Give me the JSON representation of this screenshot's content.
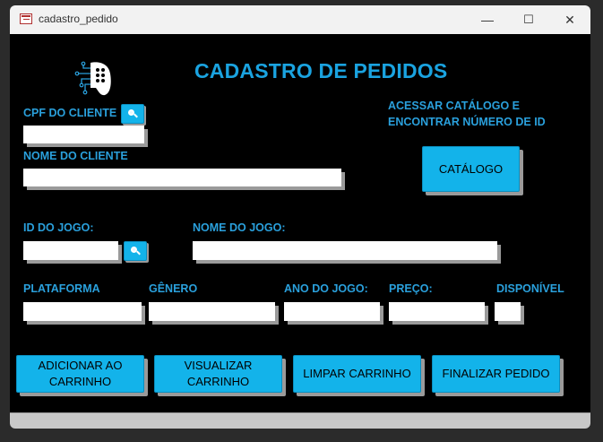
{
  "window": {
    "title": "cadastro_pedido"
  },
  "titlebar_controls": {
    "minimize": "—",
    "maximize": "☐",
    "close": "✕"
  },
  "heading": "CADASTRO DE PEDIDOS",
  "customer": {
    "cpf_label": "CPF DO CLIENTE",
    "cpf_value": "",
    "name_label": "NOME DO CLIENTE",
    "name_value": ""
  },
  "catalog": {
    "hint_line1": "ACESSAR CATÁLOGO E",
    "hint_line2": "ENCONTRAR NÚMERO DE ID",
    "button_label": "CATÁLOGO"
  },
  "game": {
    "id_label": "ID DO JOGO:",
    "id_value": "",
    "name_label": "NOME DO JOGO:",
    "name_value": "",
    "platform_label": "PLATAFORMA",
    "genre_label": "GÊNERO",
    "year_label": "ANO DO JOGO:",
    "price_label": "PREÇO:",
    "available_label": "DISPONÍVEL"
  },
  "actions": {
    "add_line1": "ADICIONAR AO",
    "add_line2": "CARRINHO",
    "view_line1": "VISUALIZAR",
    "view_line2": "CARRINHO",
    "clear": "LIMPAR CARRINHO",
    "finish": "FINALIZAR PEDIDO"
  },
  "icons": {
    "search": "search-icon",
    "logo": "gamepad-logo-icon",
    "app": "form-icon"
  },
  "colors": {
    "accent": "#13b3ea",
    "label": "#2aa0dc",
    "background": "#000000"
  }
}
